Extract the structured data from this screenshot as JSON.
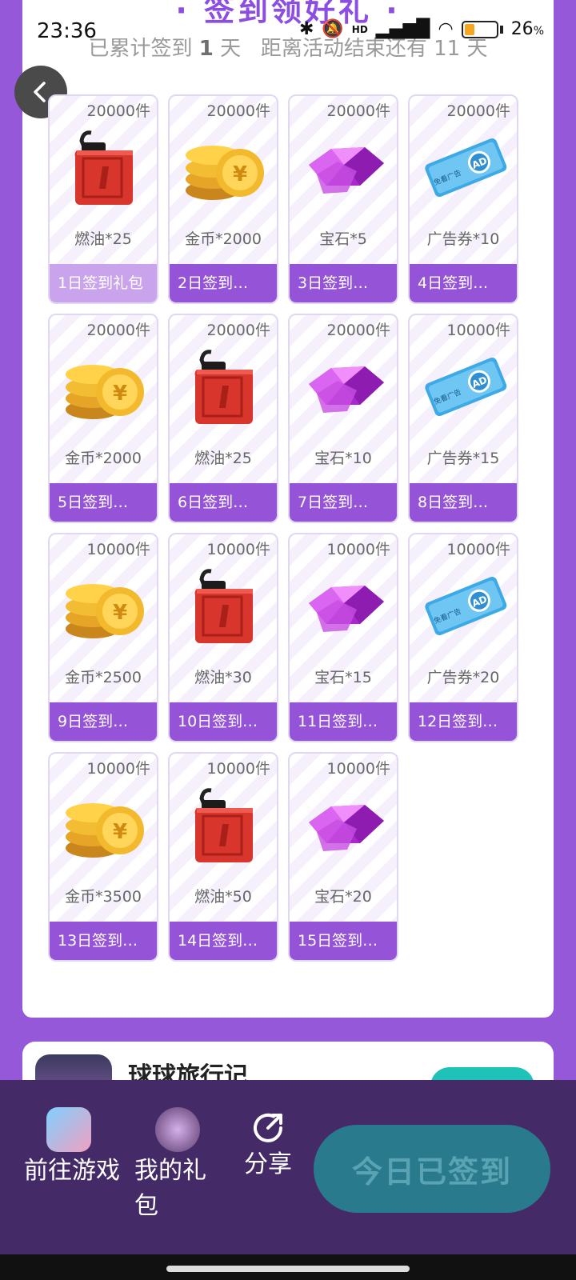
{
  "status_bar": {
    "time": "23:36",
    "battery_percent": "26",
    "battery_unit": "%",
    "hd_label": "HD"
  },
  "header": {
    "title": "签到领好礼",
    "summary_prefix": "已累计签到",
    "signed_days": "1",
    "day_unit": "天",
    "summary_middle": "距离活动结束还有",
    "remaining_days": "11",
    "ribbon_text": "一"
  },
  "rewards": [
    {
      "stock": "20000件",
      "name": "燃油*25",
      "day": "1日签到礼包",
      "icon": "fuel-can",
      "claimed": true
    },
    {
      "stock": "20000件",
      "name": "金币*2000",
      "day": "2日签到…",
      "icon": "gold-coins",
      "claimed": false
    },
    {
      "stock": "20000件",
      "name": "宝石*5",
      "day": "3日签到…",
      "icon": "gem",
      "claimed": false
    },
    {
      "stock": "20000件",
      "name": "广告券*10",
      "day": "4日签到…",
      "icon": "ad-ticket",
      "claimed": false
    },
    {
      "stock": "20000件",
      "name": "金币*2000",
      "day": "5日签到…",
      "icon": "gold-coins",
      "claimed": false
    },
    {
      "stock": "20000件",
      "name": "燃油*25",
      "day": "6日签到…",
      "icon": "fuel-can",
      "claimed": false
    },
    {
      "stock": "20000件",
      "name": "宝石*10",
      "day": "7日签到…",
      "icon": "gem",
      "claimed": false
    },
    {
      "stock": "10000件",
      "name": "广告券*15",
      "day": "8日签到…",
      "icon": "ad-ticket",
      "claimed": false
    },
    {
      "stock": "10000件",
      "name": "金币*2500",
      "day": "9日签到…",
      "icon": "gold-coins",
      "claimed": false
    },
    {
      "stock": "10000件",
      "name": "燃油*30",
      "day": "10日签到…",
      "icon": "fuel-can",
      "claimed": false
    },
    {
      "stock": "10000件",
      "name": "宝石*15",
      "day": "11日签到…",
      "icon": "gem",
      "claimed": false
    },
    {
      "stock": "10000件",
      "name": "广告券*20",
      "day": "12日签到…",
      "icon": "ad-ticket",
      "claimed": false
    },
    {
      "stock": "10000件",
      "name": "金币*3500",
      "day": "13日签到…",
      "icon": "gold-coins",
      "claimed": false
    },
    {
      "stock": "10000件",
      "name": "燃油*50",
      "day": "14日签到…",
      "icon": "fuel-can",
      "claimed": false
    },
    {
      "stock": "10000件",
      "name": "宝石*20",
      "day": "15日签到…",
      "icon": "gem",
      "claimed": false
    }
  ],
  "ad_ticket": {
    "badge": "AD",
    "small_text": "免看广告"
  },
  "game_card": {
    "title": "球球旅行记"
  },
  "bottom_bar": {
    "games_label": "前往游戏",
    "gifts_label": "我的礼包",
    "share_label": "分享",
    "checkin_label": "今日已签到"
  },
  "colors": {
    "purple": "#9553d8",
    "purple_light": "#c9a4ec",
    "bottom_bar": "#442b68",
    "checkin_button": "#2a7a8e"
  }
}
